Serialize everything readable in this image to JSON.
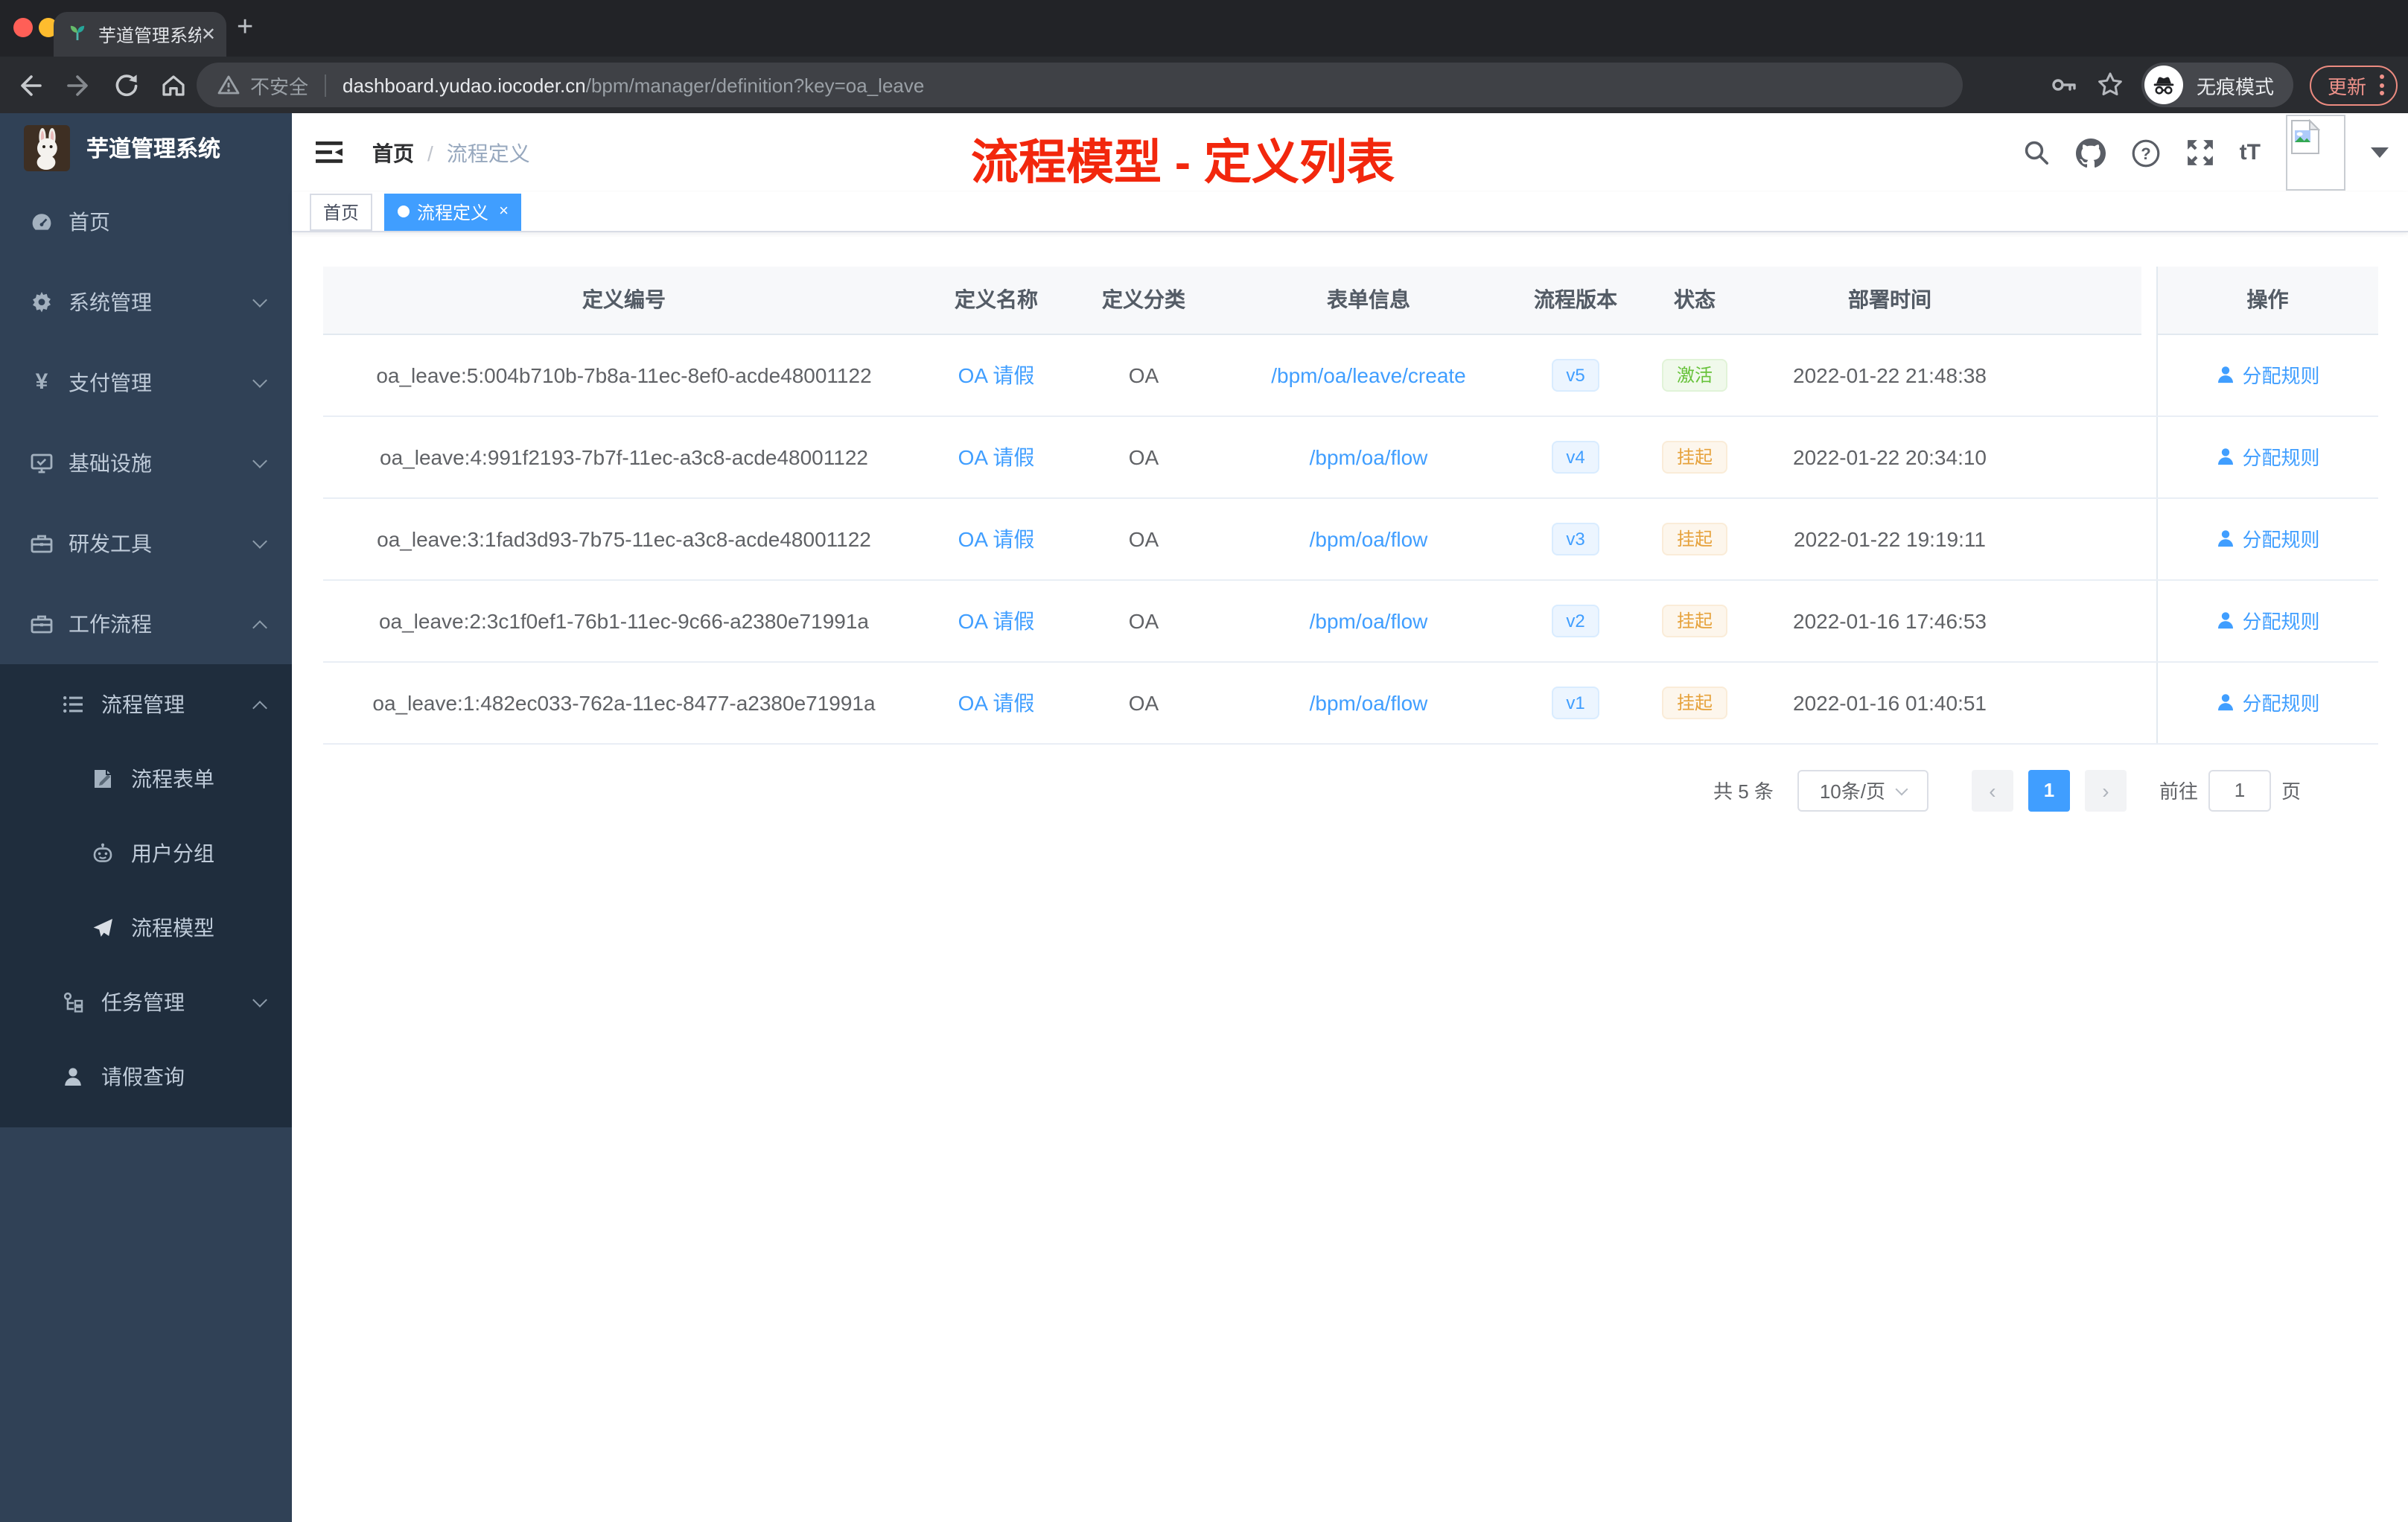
{
  "colors": {
    "accent_blue": "#409eff",
    "success_green": "#67c23a",
    "warning_orange": "#e6a23c",
    "annotation_red": "#f2270d",
    "sidebar_bg": "#304156",
    "submenu_bg": "#1f2d3d",
    "traffic_red": "#ff5f57",
    "traffic_yellow": "#febc2e",
    "traffic_green": "#28c840"
  },
  "browser": {
    "tab_title": "芋道管理系统",
    "tab_close_glyph": "✕",
    "new_tab_glyph": "+",
    "security_label": "不安全",
    "url_host": "dashboard.yudao.iocoder.cn",
    "url_path": "/bpm/manager/definition?key=oa_leave",
    "incognito_label": "无痕模式",
    "update_label": "更新"
  },
  "sidebar": {
    "app_title": "芋道管理系统",
    "menu": [
      {
        "label": "首页"
      },
      {
        "label": "系统管理"
      },
      {
        "label": "支付管理"
      },
      {
        "label": "基础设施"
      },
      {
        "label": "研发工具"
      },
      {
        "label": "工作流程"
      }
    ],
    "submenu": [
      {
        "label": "流程管理"
      },
      {
        "label": "流程表单"
      },
      {
        "label": "用户分组"
      },
      {
        "label": "流程模型"
      },
      {
        "label": "任务管理"
      },
      {
        "label": "请假查询"
      }
    ],
    "yen_glyph": "¥"
  },
  "navbar": {
    "breadcrumb_home": "首页",
    "breadcrumb_sep": "/",
    "breadcrumb_current": "流程定义",
    "text_size_icon": "tT"
  },
  "annotation": {
    "text": "流程模型 - 定义列表"
  },
  "tags": {
    "home": "首页",
    "active": "流程定义",
    "close_glyph": "×"
  },
  "table": {
    "columns": [
      "定义编号",
      "定义名称",
      "定义分类",
      "表单信息",
      "流程版本",
      "状态",
      "部署时间",
      "操作"
    ],
    "rows": [
      {
        "id": "oa_leave:5:004b710b-7b8a-11ec-8ef0-acde48001122",
        "name": "OA 请假",
        "category": "OA",
        "form": "/bpm/oa/leave/create",
        "version": "v5",
        "status": "激活",
        "time": "2022-01-22 21:48:38",
        "action": "分配规则"
      },
      {
        "id": "oa_leave:4:991f2193-7b7f-11ec-a3c8-acde48001122",
        "name": "OA 请假",
        "category": "OA",
        "form": "/bpm/oa/flow",
        "version": "v4",
        "status": "挂起",
        "time": "2022-01-22 20:34:10",
        "action": "分配规则"
      },
      {
        "id": "oa_leave:3:1fad3d93-7b75-11ec-a3c8-acde48001122",
        "name": "OA 请假",
        "category": "OA",
        "form": "/bpm/oa/flow",
        "version": "v3",
        "status": "挂起",
        "time": "2022-01-22 19:19:11",
        "action": "分配规则"
      },
      {
        "id": "oa_leave:2:3c1f0ef1-76b1-11ec-9c66-a2380e71991a",
        "name": "OA 请假",
        "category": "OA",
        "form": "/bpm/oa/flow",
        "version": "v2",
        "status": "挂起",
        "time": "2022-01-16 17:46:53",
        "action": "分配规则"
      },
      {
        "id": "oa_leave:1:482ec033-762a-11ec-8477-a2380e71991a",
        "name": "OA 请假",
        "category": "OA",
        "form": "/bpm/oa/flow",
        "version": "v1",
        "status": "挂起",
        "time": "2022-01-16 01:40:51",
        "action": "分配规则"
      }
    ]
  },
  "pagination": {
    "total": "共 5 条",
    "page_size": "10条/页",
    "prev_glyph": "‹",
    "next_glyph": "›",
    "current_page": "1",
    "goto_label": "前往",
    "goto_value": "1",
    "unit": "页"
  },
  "icons": {
    "search-icon": "magnifier css/svg shape",
    "github-icon": "github octocat mark",
    "help-icon": "question mark in circle",
    "fullscreen-icon": "four outward arrows",
    "text-size-icon": "tT glyph",
    "avatar-broken-image-icon": "broken image placeholder",
    "caret-down-icon": "▼",
    "hamburger-icon": "sidebar collapse lines",
    "dashboard-icon": "gauge",
    "gear-icon": "cog",
    "yen-icon": "¥",
    "monitor-icon": "screen with check",
    "toolbox-icon": "briefcase",
    "workflow-icon": "briefcase",
    "list-icon": "bulleted list",
    "form-icon": "document with pen",
    "robot-icon": "robot face",
    "send-icon": "paper plane",
    "tree-icon": "org tree",
    "user-icon": "person silhouette",
    "key-icon": "password key",
    "star-icon": "bookmark star",
    "incognito-icon": "hat and glasses",
    "warning-icon": "triangle alert",
    "back-icon": "arrow left",
    "forward-icon": "arrow right",
    "reload-icon": "circular arrow",
    "home-icon": "house",
    "favicon-sprout-icon": "sprout leaves"
  }
}
